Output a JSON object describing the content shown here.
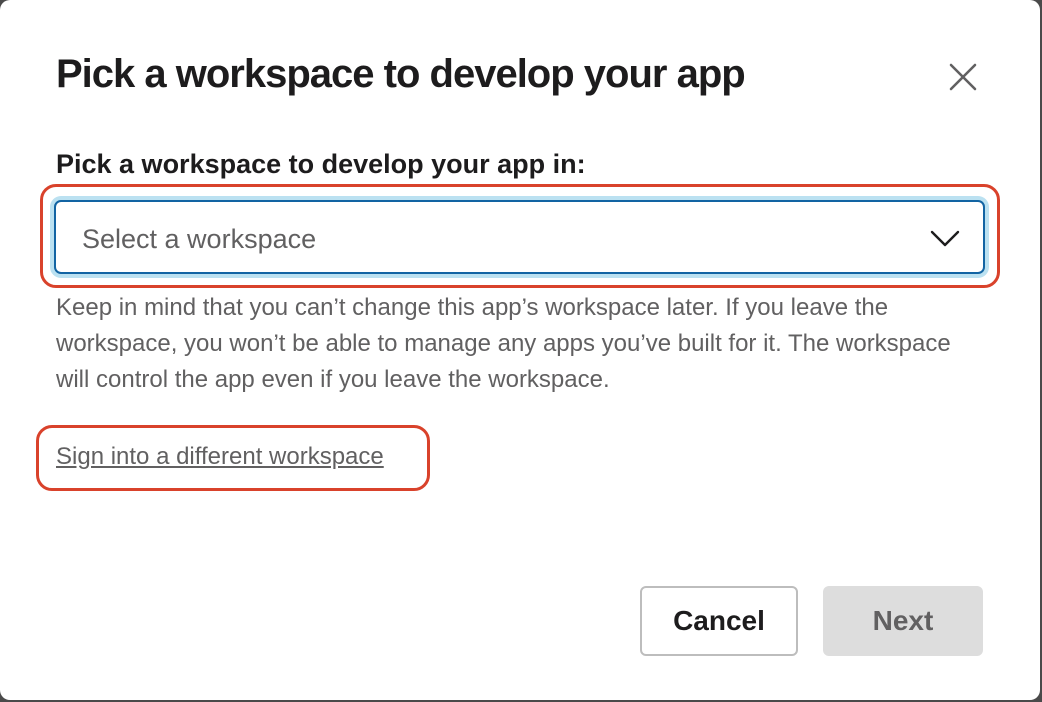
{
  "dialog": {
    "title": "Pick a workspace to develop your app",
    "close_icon": "close-icon"
  },
  "workspace_field": {
    "label": "Pick a workspace to develop your app in:",
    "placeholder": "Select a workspace",
    "chevron_icon": "chevron-down-icon",
    "helper_text": "Keep in mind that you can’t change this app’s workspace later. If you leave the workspace, you won’t be able to manage any apps you’ve built for it. The workspace will control the app even if you leave the workspace."
  },
  "alternate_link": {
    "label": "Sign into a different workspace"
  },
  "footer": {
    "cancel_label": "Cancel",
    "next_label": "Next"
  },
  "colors": {
    "annotation_outline": "#d9422b",
    "focus_border": "#1264a3",
    "text_primary": "#1d1c1d",
    "text_secondary": "#616061",
    "disabled_button_bg": "#dddddd"
  }
}
